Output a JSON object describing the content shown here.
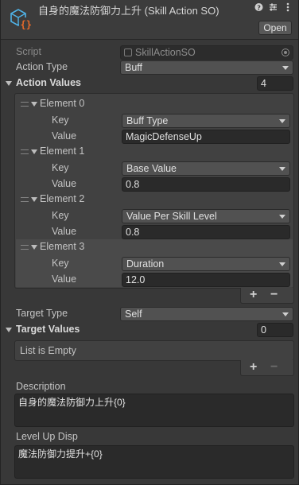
{
  "header": {
    "title": "自身的魔法防御力上升 (Skill Action SO)",
    "open_label": "Open",
    "icons": [
      "help-icon",
      "preset-icon",
      "more-options-icon"
    ]
  },
  "fields": {
    "script_label": "Script",
    "script_value": "SkillActionSO",
    "action_type_label": "Action Type",
    "action_type_value": "Buff"
  },
  "action_values": {
    "label": "Action Values",
    "size": "4",
    "elements": [
      {
        "name": "Element 0",
        "key_label": "Key",
        "key_value": "Buff Type",
        "value_label": "Value",
        "value": "MagicDefenseUp"
      },
      {
        "name": "Element 1",
        "key_label": "Key",
        "key_value": "Base Value",
        "value_label": "Value",
        "value": "0.8"
      },
      {
        "name": "Element 2",
        "key_label": "Key",
        "key_value": "Value Per Skill Level",
        "value_label": "Value",
        "value": "0.8"
      },
      {
        "name": "Element 3",
        "key_label": "Key",
        "key_value": "Duration",
        "value_label": "Value",
        "value": "12.0"
      }
    ],
    "add_label": "+",
    "remove_label": "−"
  },
  "target": {
    "type_label": "Target Type",
    "type_value": "Self",
    "values_label": "Target Values",
    "values_size": "0",
    "empty_text": "List is Empty",
    "add_label": "+",
    "remove_label": "−"
  },
  "description": {
    "label": "Description",
    "value": "自身的魔法防御力上升{0}"
  },
  "level_up": {
    "label": "Level Up Disp",
    "value": "魔法防御力提升+{0}"
  },
  "colors": {
    "background": "#383838",
    "field_dark": "#2a2a2a",
    "dropdown": "#515151",
    "icon_blue": "#4fb3e8",
    "icon_orange": "#e86a2a"
  }
}
